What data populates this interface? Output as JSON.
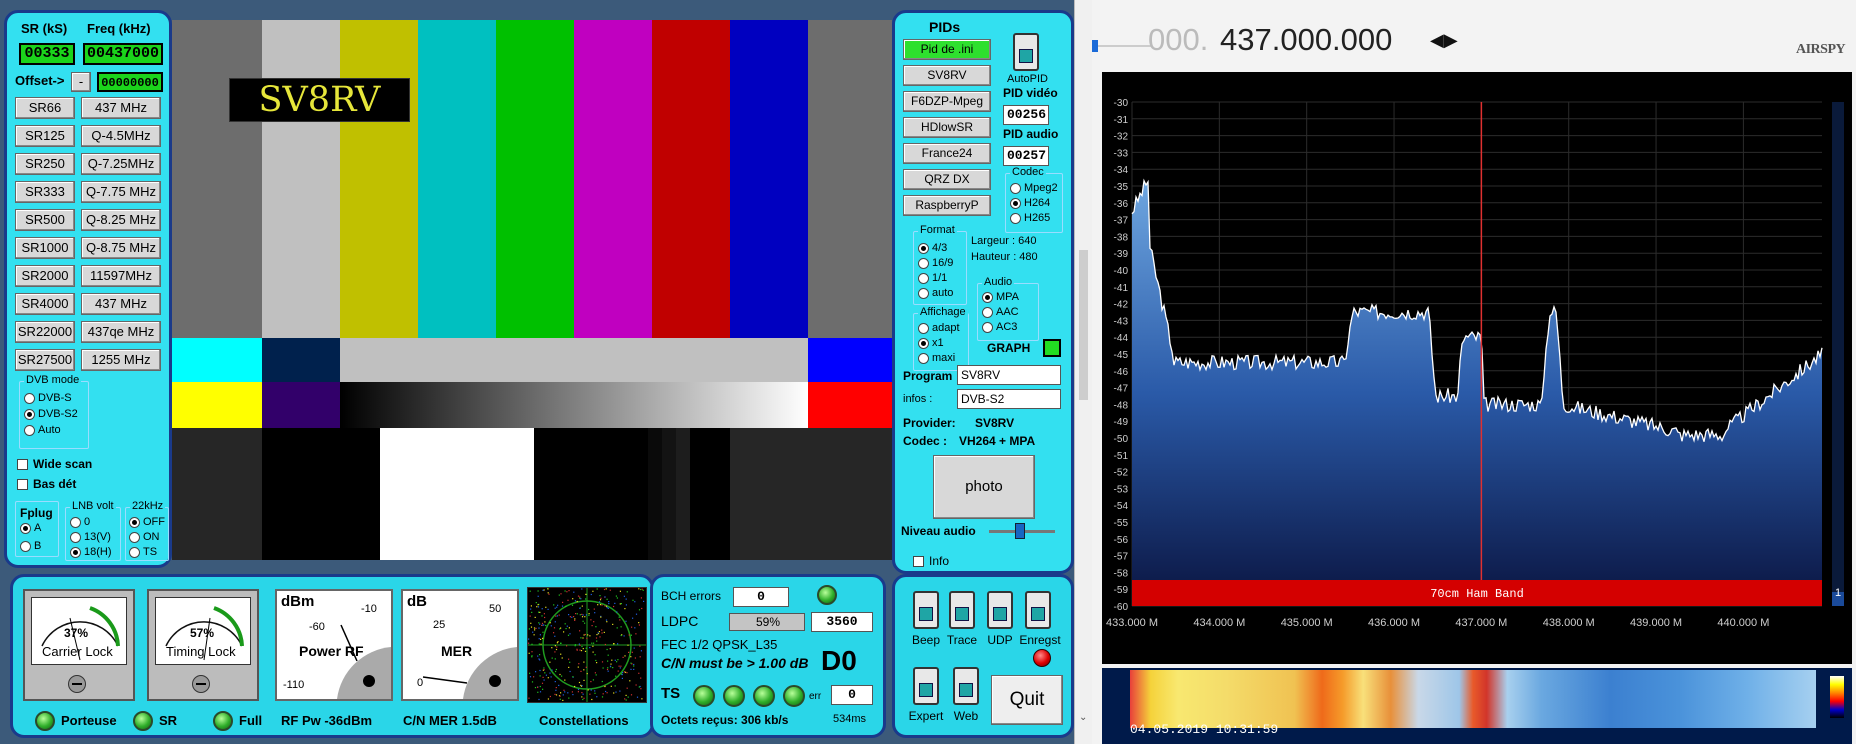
{
  "left": {
    "sr_label": "SR (kS)",
    "freq_label": "Freq (kHz)",
    "sr_value": "00333",
    "freq_value": "00437000",
    "offset_label": "Offset->",
    "offset_sign": "-",
    "offset_value": "00000000",
    "sr_buttons": [
      "SR66",
      "SR125",
      "SR250",
      "SR333",
      "SR500",
      "SR1000",
      "SR2000",
      "SR4000",
      "SR22000",
      "SR27500"
    ],
    "freq_buttons": [
      "437 MHz",
      "Q-4.5MHz",
      "Q-7.25MHz",
      "Q-7.75 MHz",
      "Q-8.25 MHz",
      "Q-8.75 MHz",
      "11597MHz",
      "437 MHz",
      "437qe MHz",
      "1255 MHz"
    ],
    "dvb_title": "DVB mode",
    "dvb_options": [
      "DVB-S",
      "DVB-S2",
      "Auto"
    ],
    "dvb_selected": "DVB-S2",
    "wide_scan": "Wide scan",
    "bas_det": "Bas dét",
    "fplug_title": "Fplug",
    "fplug_options": [
      "A",
      "B"
    ],
    "lnb_title": "LNB volt",
    "lnb_options": [
      "0",
      "13(V)",
      "18(H)"
    ],
    "khz_title": "22kHz",
    "khz_options": [
      "OFF",
      "ON",
      "TS"
    ]
  },
  "video": {
    "callsign": "SV8RV"
  },
  "pids": {
    "title": "PIDs",
    "buttons": [
      "Pid de .ini",
      "SV8RV",
      "F6DZP-Mpeg",
      "HDlowSR",
      "France24",
      "QRZ DX",
      "RaspberryP"
    ],
    "autopid": "AutoPID",
    "pid_video_label": "PID vidéo",
    "pid_video": "00256",
    "pid_audio_label": "PID audio",
    "pid_audio": "00257",
    "codec_title": "Codec",
    "codec_options": [
      "Mpeg2",
      "H264",
      "H265"
    ],
    "format_title": "Format",
    "format_options": [
      "4/3",
      "16/9",
      "1/1",
      "auto"
    ],
    "largeur": "Largeur :   640",
    "hauteur": "Hauteur :  480",
    "audio_title": "Audio",
    "audio_options": [
      "MPA",
      "AAC",
      "AC3"
    ],
    "affichage_title": "Affichage",
    "affichage_options": [
      "adapt",
      "x1",
      "maxi"
    ],
    "graph_label": "GRAPH",
    "program_label": "Program",
    "program_value": "SV8RV",
    "infos_label": "infos :",
    "infos_value": "DVB-S2",
    "provider_label": "Provider:",
    "provider_value": "SV8RV",
    "codec_label": "Codec :",
    "codec_value": "VH264 + MPA",
    "photo": "photo",
    "niveau_audio": "Niveau audio",
    "info": "Info"
  },
  "meters": {
    "carrier_pct": "37%",
    "carrier_label": "Carrier Lock",
    "timing_pct": "57%",
    "timing_label": "Timing Lock",
    "dbm_unit": "dBm",
    "dbm_ticks": [
      "-60",
      "-10",
      "-110"
    ],
    "power_label": "Power RF",
    "db_unit": "dB",
    "db_ticks": [
      "25",
      "50",
      "0"
    ],
    "mer_label": "MER",
    "porteuse": "Porteuse",
    "sr": "SR",
    "full": "Full",
    "rf_pw": "RF Pw -36dBm",
    "cn_mer": "C/N MER 1.5dB",
    "constellations": "Constellations"
  },
  "status": {
    "bch_label": "BCH errors",
    "bch_value": "0",
    "ldpc_label": "LDPC",
    "ldpc_pct": "59%",
    "ldpc_fill": 0.59,
    "ldpc_value": "3560",
    "fec": "FEC   1/2 QPSK_L35",
    "cn_must": "C/N must be > 1.00 dB",
    "d0": "D0",
    "ts_label": "TS",
    "err_label": "err",
    "err_value": "0",
    "octets": "Octets reçus: 306 kb/s",
    "ms": "534ms"
  },
  "controls": {
    "switches": [
      "Beep",
      "Trace",
      "UDP",
      "Enregst",
      "Expert",
      "Web"
    ],
    "quit": "Quit"
  },
  "sdr": {
    "freq_dim": "000.",
    "freq_main": "437.000.000",
    "brand": "AIRSPY",
    "ylabels": [
      "-30",
      "-31",
      "-32",
      "-33",
      "-34",
      "-35",
      "-36",
      "-37",
      "-38",
      "-39",
      "-40",
      "-41",
      "-42",
      "-43",
      "-44",
      "-45",
      "-46",
      "-47",
      "-48",
      "-49",
      "-50",
      "-51",
      "-52",
      "-53",
      "-54",
      "-55",
      "-56",
      "-57",
      "-58",
      "-59",
      "-60"
    ],
    "xlabels": [
      "433.000 M",
      "434.000 M",
      "435.000 M",
      "436.000 M",
      "437.000 M",
      "438.000 M",
      "439.000 M",
      "440.000 M"
    ],
    "band_label": "70cm Ham Band",
    "scroll_num": "1",
    "timestamp": "04.05.2019 10:31:59"
  }
}
